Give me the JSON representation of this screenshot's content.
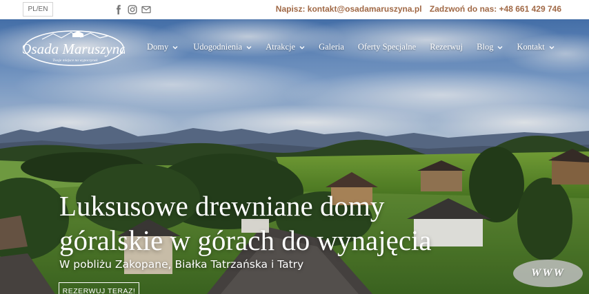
{
  "topbar": {
    "lang_pl": "PL",
    "lang_sep": " / ",
    "lang_en": "EN",
    "email_label": "Napisz: kontakt@osadamaruszyna.pl",
    "phone_label": "Zadzwoń do nas: +48 661 429 746",
    "accent_color": "#a06845",
    "social_icons": [
      "facebook-icon",
      "instagram-icon",
      "mail-icon"
    ]
  },
  "logo": {
    "name": "Osada Maruszyna",
    "tagline": "Twoje miejsce na wypoczynek"
  },
  "nav": {
    "items": [
      {
        "label": "Domy",
        "has_dropdown": true
      },
      {
        "label": "Udogodnienia",
        "has_dropdown": true
      },
      {
        "label": "Atrakcje",
        "has_dropdown": true
      },
      {
        "label": "Galeria",
        "has_dropdown": false
      },
      {
        "label": "Oferty Specjalne",
        "has_dropdown": false
      },
      {
        "label": "Rezerwuj",
        "has_dropdown": false
      },
      {
        "label": "Blog",
        "has_dropdown": true
      },
      {
        "label": "Kontakt",
        "has_dropdown": true
      }
    ]
  },
  "hero": {
    "headline_line1": "Luksusowe drewniane domy",
    "headline_line2": "góralskie w górach do wynajęcia",
    "subline": "W pobliżu Zakopane, Białka Tatrzańska i Tatry",
    "cta_label": "REZERWUJ TERAZ!"
  },
  "badge": {
    "label": "WWW"
  }
}
